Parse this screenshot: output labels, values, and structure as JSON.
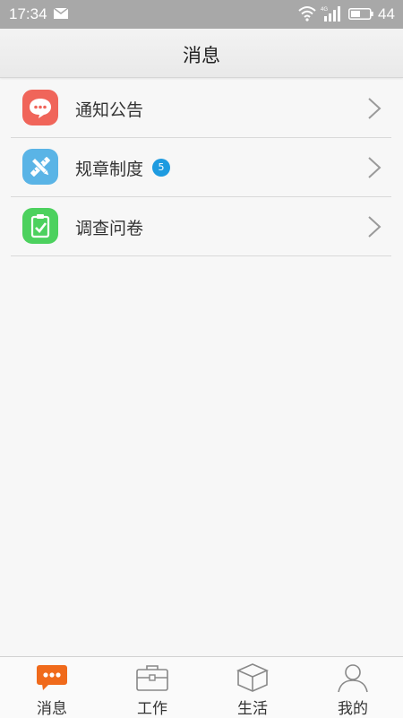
{
  "status_bar": {
    "time": "17:34",
    "battery_level": "44",
    "network": "4G",
    "icons": [
      "mail-icon",
      "wifi-icon",
      "signal-icon",
      "battery-icon"
    ]
  },
  "header": {
    "title": "消息"
  },
  "list": {
    "items": [
      {
        "label": "通知公告",
        "icon": "chat-bubble-icon",
        "icon_color": "#f0655a",
        "badge": null
      },
      {
        "label": "规章制度",
        "icon": "pencil-ruler-icon",
        "icon_color": "#5ab4e6",
        "badge": "5"
      },
      {
        "label": "调查问卷",
        "icon": "clipboard-check-icon",
        "icon_color": "#4cd15e",
        "badge": null
      }
    ]
  },
  "tabs": [
    {
      "label": "消息",
      "icon": "message-icon",
      "active": true
    },
    {
      "label": "工作",
      "icon": "briefcase-icon",
      "active": false
    },
    {
      "label": "生活",
      "icon": "box-icon",
      "active": false
    },
    {
      "label": "我的",
      "icon": "person-icon",
      "active": false
    }
  ],
  "colors": {
    "accent": "#f06a1b",
    "badge": "#1e9be0",
    "status_bar": "#a8a8a8"
  }
}
